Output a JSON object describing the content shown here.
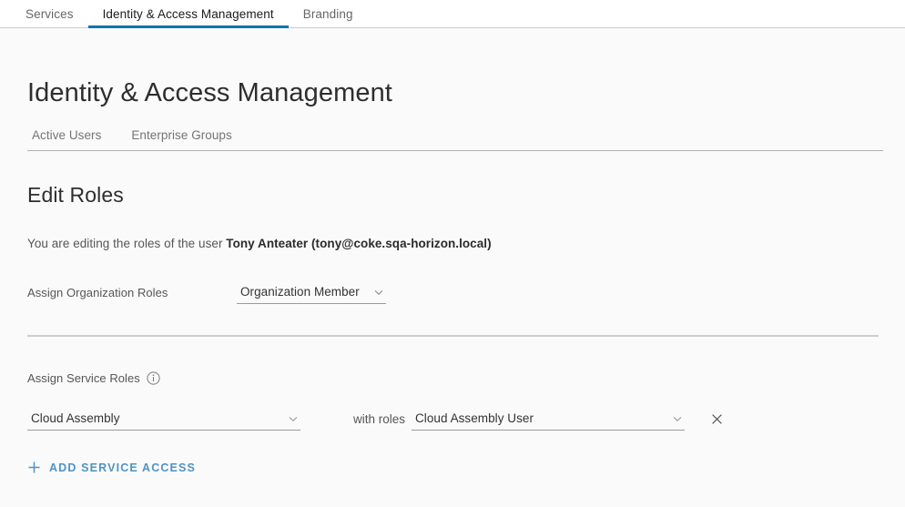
{
  "topbar": {
    "tabs": [
      {
        "label": "Services",
        "active": false
      },
      {
        "label": "Identity & Access Management",
        "active": true
      },
      {
        "label": "Branding",
        "active": false
      }
    ]
  },
  "page": {
    "title": "Identity & Access Management"
  },
  "subnav": {
    "items": [
      {
        "label": "Active Users"
      },
      {
        "label": "Enterprise Groups"
      }
    ]
  },
  "section": {
    "title": "Edit Roles",
    "editing_prefix": "You are editing the roles of the user ",
    "editing_user": "Tony Anteater (tony@coke.sqa-horizon.local)"
  },
  "org_roles": {
    "label": "Assign Organization Roles",
    "selected": "Organization Member",
    "caret_icon": "chevron-down-icon"
  },
  "service_roles": {
    "label": "Assign Service Roles",
    "info_icon": "info-circle-icon",
    "with_roles_label": "with roles",
    "rows": [
      {
        "service": "Cloud Assembly",
        "role": "Cloud Assembly User",
        "remove_icon": "close-icon"
      }
    ],
    "add_label": "ADD SERVICE ACCESS",
    "add_icon": "plus-icon"
  },
  "colors": {
    "accent": "#0f76ab",
    "link": "#4f93c4",
    "background": "#fafafa",
    "topbar_background": "#ffffff",
    "divider": "#cdcdcd",
    "underline": "#9a9a9a",
    "text": "#313131",
    "muted_text": "#565656"
  }
}
